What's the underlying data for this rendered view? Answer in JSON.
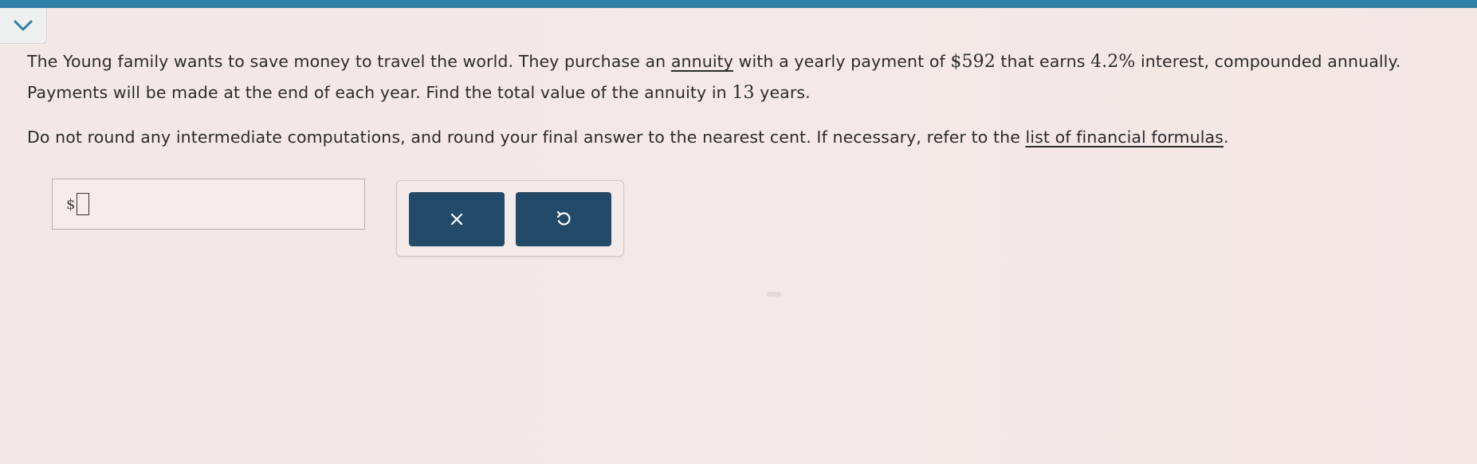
{
  "question": {
    "p1": {
      "a": "The Young family wants to save money to travel the world. They purchase an ",
      "annuity_link": "annuity",
      "b": " with a yearly payment of ",
      "payment": "$592",
      "c": " that earns ",
      "rate": "4.2%",
      "d": " interest, compounded annually. Payments will be made at the end of each year. Find the total value of the annuity in ",
      "years": "13",
      "e": " years."
    },
    "p2": {
      "a": "Do not round any intermediate computations, and round your final answer to the nearest cent. If necessary, refer to the ",
      "formulas_link": "list of financial formulas",
      "b": "."
    }
  },
  "answer": {
    "prefix": "$",
    "value": ""
  },
  "icons": {
    "collapse": "chevron-down-icon",
    "clear": "close-icon",
    "undo": "undo-icon"
  },
  "colors": {
    "top_bar": "#2f7fa6",
    "button_bg": "#234a68"
  }
}
